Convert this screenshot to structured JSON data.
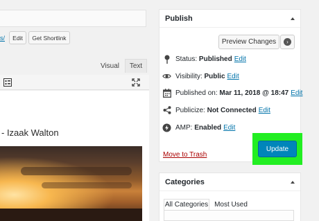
{
  "editor": {
    "permalink_tail": "s/",
    "edit_label": "Edit",
    "shortlink_label": "Get Shortlink",
    "tab_visual": "Visual",
    "tab_text": "Text",
    "author_line": "- Izaak Walton"
  },
  "publish": {
    "title": "Publish",
    "preview_label": "Preview Changes",
    "status_label": "Status:",
    "status_value": "Published",
    "visibility_label": "Visibility:",
    "visibility_value": "Public",
    "published_on_label": "Published on:",
    "published_on_value": "Mar 11, 2018 @ 18:47",
    "publicize_label": "Publicize:",
    "publicize_value": "Not Connected",
    "amp_label": "AMP:",
    "amp_value": "Enabled",
    "edit_label": "Edit",
    "trash_label": "Move to Trash",
    "update_label": "Update"
  },
  "categories": {
    "title": "Categories",
    "tab_all": "All Categories",
    "tab_most_used": "Most Used"
  },
  "colors": {
    "primary_button": "#0085ba",
    "highlight": "#22ee22",
    "link": "#0073aa",
    "trash": "#aa0000"
  }
}
